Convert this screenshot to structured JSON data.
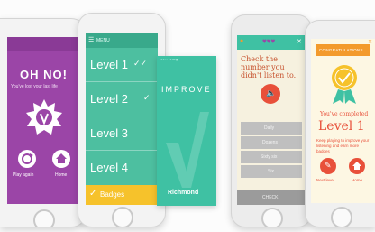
{
  "phone1": {
    "title": "OH NO!",
    "subtitle": "You've lost your last life",
    "play_again": "Play again",
    "home": "Home"
  },
  "phone2": {
    "header": "MENU",
    "levels": [
      "Level 1",
      "Level 2",
      "Level 3",
      "Level 4"
    ],
    "badges": "Badges"
  },
  "phone3": {
    "brand": "IMPROVE",
    "publisher": "Richmond"
  },
  "phone4": {
    "question": "Check the number you didn't listen to.",
    "options": [
      "Daily",
      "Dozens",
      "Sixty six",
      "Six"
    ],
    "footer": "CHECK"
  },
  "phone5": {
    "banner": "CONGRATULATIONS",
    "completed": "You've completed",
    "level": "Level 1",
    "message": "Keep playing to improve your listening and earn more badges",
    "next_level": "Next level",
    "home": "Home"
  },
  "colors": {
    "purple": "#9b45a7",
    "teal": "#3fc1a3",
    "menu_teal": "#4dbfa0",
    "orange": "#f39a2c",
    "red": "#e8503a",
    "yellow": "#f6c22b"
  },
  "icons": [
    "medal-icon",
    "restart-icon",
    "home-icon",
    "checkmark-icon",
    "speaker-icon",
    "close-icon",
    "heart-icon",
    "badge-icon"
  ]
}
